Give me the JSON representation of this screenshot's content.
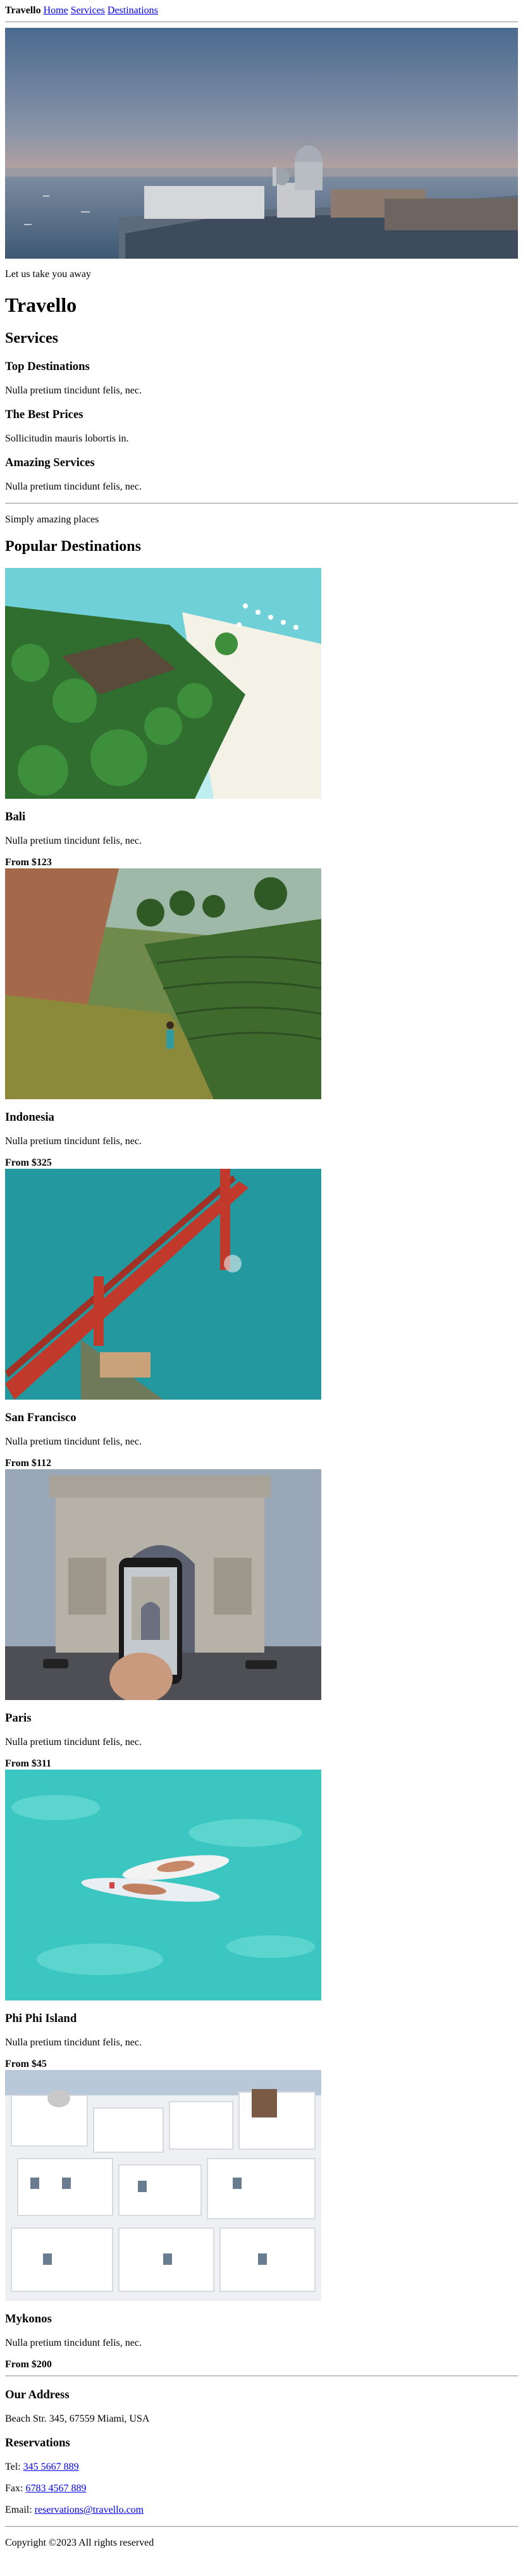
{
  "nav": {
    "brand": "Travello",
    "links": [
      "Home",
      "Services",
      "Destinations"
    ]
  },
  "hero": {
    "image_icon": "venice-skyline-image",
    "tagline": "Let us take you away",
    "title": "Travello"
  },
  "services": {
    "heading": "Services",
    "items": [
      {
        "title": "Top Destinations",
        "text": "Nulla pretium tincidunt felis, nec."
      },
      {
        "title": "The Best Prices",
        "text": "Sollicitudin mauris lobortis in."
      },
      {
        "title": "Amazing Services",
        "text": "Nulla pretium tincidunt felis, nec."
      }
    ]
  },
  "destinations": {
    "tagline": "Simply amazing places",
    "heading": "Popular Destinations",
    "items": [
      {
        "name": "Bali",
        "text": "Nulla pretium tincidunt felis, nec.",
        "price": "From $123",
        "image_icon": "bali-beach-image"
      },
      {
        "name": "Indonesia",
        "text": "Nulla pretium tincidunt felis, nec.",
        "price": "From $325",
        "image_icon": "rice-terrace-image"
      },
      {
        "name": "San Francisco",
        "text": "Nulla pretium tincidunt felis, nec.",
        "price": "From $112",
        "image_icon": "golden-gate-bridge-image"
      },
      {
        "name": "Paris",
        "text": "Nulla pretium tincidunt felis, nec.",
        "price": "From $311",
        "image_icon": "arc-de-triomphe-image"
      },
      {
        "name": "Phi Phi Island",
        "text": "Nulla pretium tincidunt felis, nec.",
        "price": "From $45",
        "image_icon": "paddleboard-sea-image"
      },
      {
        "name": "Mykonos",
        "text": "Nulla pretium tincidunt felis, nec.",
        "price": "From $200",
        "image_icon": "white-village-image"
      }
    ]
  },
  "footer": {
    "address_heading": "Our Address",
    "address": "Beach Str. 345, 67559 Miami, USA",
    "reservations_heading": "Reservations",
    "tel_label": "Tel: ",
    "tel": "345 5667 889",
    "fax_label": "Fax: ",
    "fax": "6783 4567 889",
    "email_label": "Email: ",
    "email": "reservations@travello.com",
    "copyright": "Copyright ©2023 All rights reserved"
  }
}
